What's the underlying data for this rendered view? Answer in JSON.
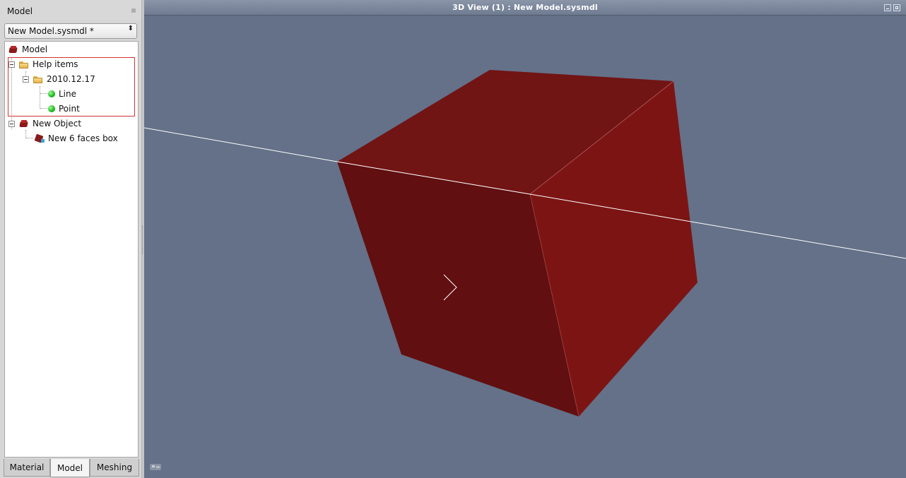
{
  "panel": {
    "title": "Model",
    "file_selector": {
      "value": "New Model.sysmdl *",
      "arrows": "⬍"
    }
  },
  "tree": {
    "items": [
      {
        "label": "Model",
        "icon": "model-box-icon"
      },
      {
        "label": "Help items",
        "icon": "folder-icon"
      },
      {
        "label": "2010.12.17",
        "icon": "folder-icon"
      },
      {
        "label": "Line",
        "icon": "green-dot-icon"
      },
      {
        "label": "Point",
        "icon": "green-dot-icon"
      },
      {
        "label": "New Object",
        "icon": "object-box-icon"
      },
      {
        "label": "New 6 faces box",
        "icon": "box-shape-icon"
      }
    ],
    "highlight_color": "#d23333"
  },
  "tabs": [
    {
      "label": "Material",
      "active": false
    },
    {
      "label": "Model",
      "active": true
    },
    {
      "label": "Meshing",
      "active": false
    }
  ],
  "view": {
    "title": "3D View (1) : New Model.sysmdl",
    "background_color": "#647189",
    "box_colors": {
      "top": "#711414",
      "left": "#610f10",
      "right": "#7d1414"
    }
  }
}
